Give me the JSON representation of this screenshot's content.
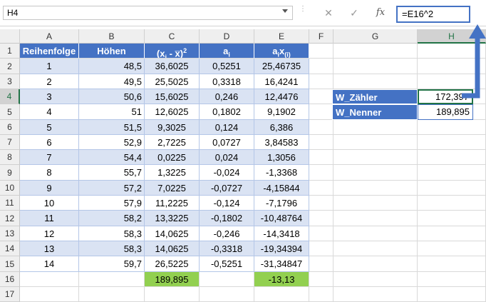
{
  "formula_bar": {
    "name_box": "H4",
    "cancel_icon": "✕",
    "enter_icon": "✓",
    "fx_label": "fx",
    "formula": "=E16^2"
  },
  "columns": [
    "A",
    "B",
    "C",
    "D",
    "E",
    "F",
    "G",
    "H"
  ],
  "rows": [
    "1",
    "2",
    "3",
    "4",
    "5",
    "6",
    "7",
    "8",
    "9",
    "10",
    "11",
    "12",
    "13",
    "14",
    "15",
    "16",
    "17"
  ],
  "table": {
    "headers": {
      "a": "Reihenfolge",
      "b": "Höhen",
      "c_pre": "(x",
      "c_sub": "i",
      "c_mid": " - x̅)",
      "c_sup": "2",
      "d_pre": "a",
      "d_sub": "i",
      "e_pre": "a",
      "e_sub1": "i",
      "e_mid": "x",
      "e_sub2": "(i)"
    },
    "data": [
      [
        "1",
        "48,5",
        "36,6025",
        "0,5251",
        "25,46735"
      ],
      [
        "2",
        "49,5",
        "25,5025",
        "0,3318",
        "16,4241"
      ],
      [
        "3",
        "50,6",
        "15,6025",
        "0,246",
        "12,4476"
      ],
      [
        "4",
        "51",
        "12,6025",
        "0,1802",
        "9,1902"
      ],
      [
        "5",
        "51,5",
        "9,3025",
        "0,124",
        "6,386"
      ],
      [
        "6",
        "52,9",
        "2,7225",
        "0,0727",
        "3,84583"
      ],
      [
        "7",
        "54,4",
        "0,0225",
        "0,024",
        "1,3056"
      ],
      [
        "8",
        "55,7",
        "1,3225",
        "-0,024",
        "-1,3368"
      ],
      [
        "9",
        "57,2",
        "7,0225",
        "-0,0727",
        "-4,15844"
      ],
      [
        "10",
        "57,9",
        "11,2225",
        "-0,124",
        "-7,1796"
      ],
      [
        "11",
        "58,2",
        "13,3225",
        "-0,1802",
        "-10,48764"
      ],
      [
        "12",
        "58,3",
        "14,0625",
        "-0,246",
        "-14,3418"
      ],
      [
        "13",
        "58,3",
        "14,0625",
        "-0,3318",
        "-19,34394"
      ],
      [
        "14",
        "59,7",
        "26,5225",
        "-0,5251",
        "-31,34847"
      ]
    ],
    "totals": {
      "c": "189,895",
      "e": "-13,13"
    }
  },
  "side": {
    "w_zaehler_label": "W_Zähler",
    "w_zaehler_value": "172,397",
    "w_nenner_label": "W_Nenner",
    "w_nenner_value": "189,895"
  },
  "colors": {
    "header_blue": "#4472c4",
    "band_blue": "#dae3f3",
    "total_green": "#92d050",
    "arrow_blue": "#4472c4"
  }
}
